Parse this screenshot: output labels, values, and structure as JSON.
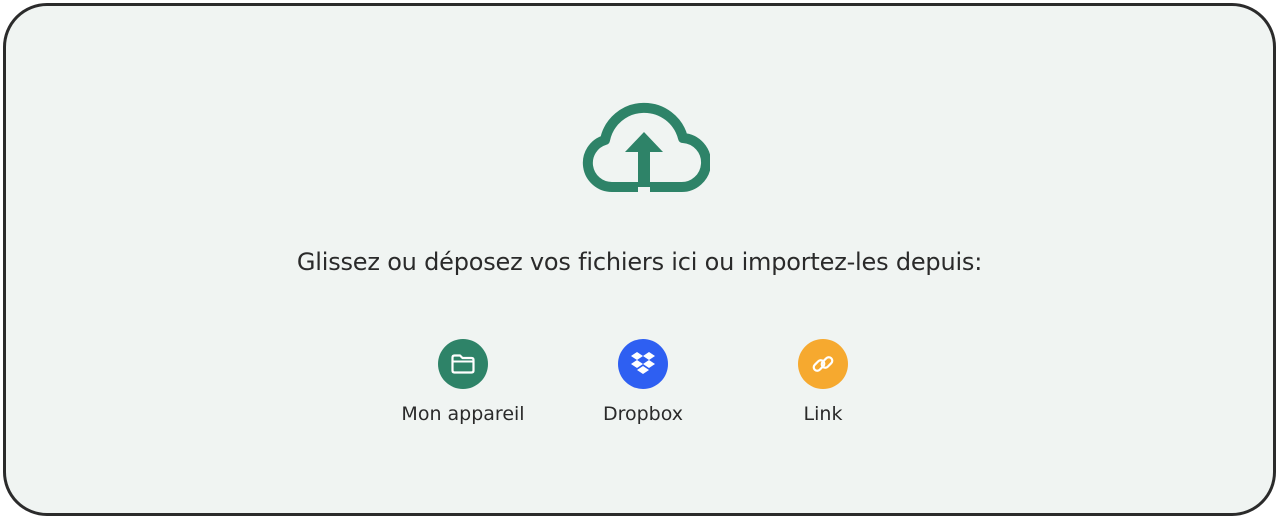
{
  "dropzone": {
    "icon": "cloud-upload-icon",
    "prompt": "Glissez ou déposez vos fichiers ici ou importez-les depuis:"
  },
  "sources": [
    {
      "label": "Mon appareil",
      "icon": "folder-icon",
      "color": "#2e8368"
    },
    {
      "label": "Dropbox",
      "icon": "dropbox-icon",
      "color": "#2e5ff2"
    },
    {
      "label": "Link",
      "icon": "link-icon",
      "color": "#f6a92f"
    }
  ],
  "colors": {
    "accent": "#2e8368",
    "background": "#f0f4f2",
    "border": "#2b2b2b"
  }
}
